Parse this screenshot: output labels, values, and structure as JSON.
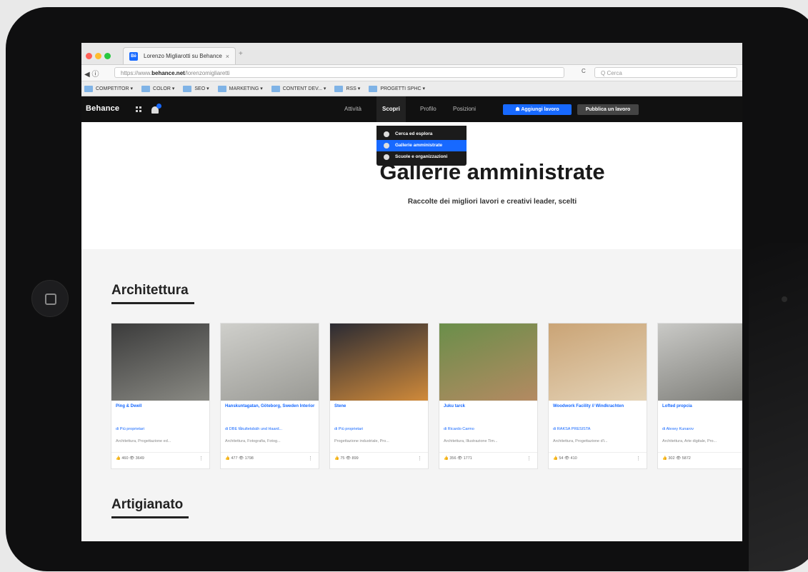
{
  "browser": {
    "tab_title": "Lorenzo Migliarotti su Behance",
    "tab_favicon": "Bē",
    "tab_close": "×",
    "new_tab": "+",
    "url_prefix": "https://www.",
    "url_domain": "behance.net",
    "url_path": "/lorenzomigliaretti",
    "reload_glyph": "C",
    "search_placeholder": "Q Cerca",
    "bookmarks": [
      "COMPETITOR",
      "COLOR",
      "SEO",
      "MARKETING",
      "CONTENT DEV...",
      "RSS",
      "PROGETTI SPHC"
    ]
  },
  "behance_nav": {
    "logo": "Behance",
    "items": [
      "Attività",
      "Scopri",
      "Profilo",
      "Posizioni"
    ],
    "active": "Scopri",
    "add_work_label": "Aggiungi lavoro",
    "publish_label": "Pubblica un lavoro"
  },
  "dropdown": {
    "items": [
      "Cerca ed esplora",
      "Gallerie amministrate",
      "Scuole e organizzazioni"
    ],
    "selected_index": 1
  },
  "hero": {
    "title": "Gallerie amministrate",
    "subtitle": "Raccolte dei migliori lavori e creativi leader, scelti"
  },
  "sections": [
    {
      "title": "Architettura"
    },
    {
      "title": "Artigianato"
    }
  ],
  "cards": [
    {
      "title": "Ping & Dwell",
      "owner": "di Più proprietari",
      "fields": "Architettura, Progettazione ed...",
      "stats": "👍 460  👁 3649",
      "img": [
        "#3b3b3b",
        "#8a8a84"
      ]
    },
    {
      "title": "Hanskuntagatan, Göteborg, Sweden Interior",
      "owner": "di DBE fåkultetsbäh und Haard...",
      "fields": "Architettura, Fotografia, Fotog...",
      "stats": "👍 477  👁 1798",
      "img": [
        "#cfcfcb",
        "#9a9a95"
      ]
    },
    {
      "title": "Stene",
      "owner": "di Più proprietari",
      "fields": "Progettazione industriale, Pro...",
      "stats": "👍 75  👁 899",
      "img": [
        "#2b2b33",
        "#d08a3a"
      ]
    },
    {
      "title": "Juku tarck",
      "owner": "di Ricardo Carmo",
      "fields": "Architettura, Illustrazione Tim...",
      "stats": "👍 356  👁 1771",
      "img": [
        "#6a8e4a",
        "#b48a62"
      ]
    },
    {
      "title": "Woodwork Facility // Windkrachten",
      "owner": "di RAKSA PRESISTA",
      "fields": "Architettura, Progettazione d'i...",
      "stats": "👍 54  👁 410",
      "img": [
        "#caa476",
        "#e4d3b7"
      ]
    },
    {
      "title": "Lofted propcia",
      "owner": "di Alexey Kunarov",
      "fields": "Architettura, Arte digitale, Pro...",
      "stats": "👍 302  👁 5872",
      "img": [
        "#c9c9c6",
        "#7b7b76"
      ]
    }
  ],
  "colors": {
    "accent": "#1769ff",
    "nav_bg": "#111111"
  }
}
